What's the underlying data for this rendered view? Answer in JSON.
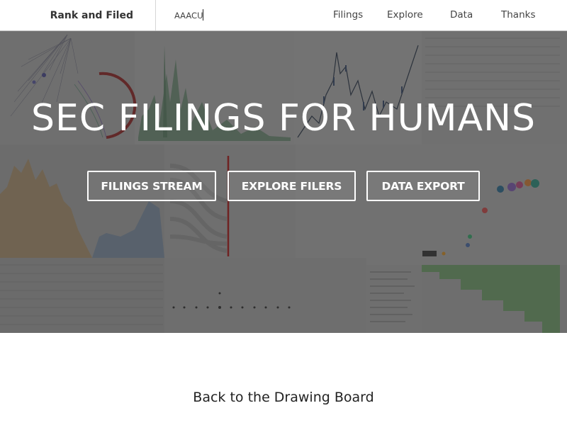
{
  "nav": {
    "brand": "Rank and Filed",
    "search_value": "AAACU",
    "links": [
      "Filings",
      "Explore",
      "Data",
      "Thanks"
    ]
  },
  "hero": {
    "title": "SEC FILINGS FOR HUMANS",
    "buttons": [
      "FILINGS STREAM",
      "EXPLORE FILERS",
      "DATA EXPORT"
    ]
  },
  "footer": {
    "link": "Back to the Drawing Board"
  },
  "colors": {
    "nav_bg": "#ffffff",
    "hero_overlay": "#3a3a3a",
    "hero_text": "#ffffff"
  }
}
